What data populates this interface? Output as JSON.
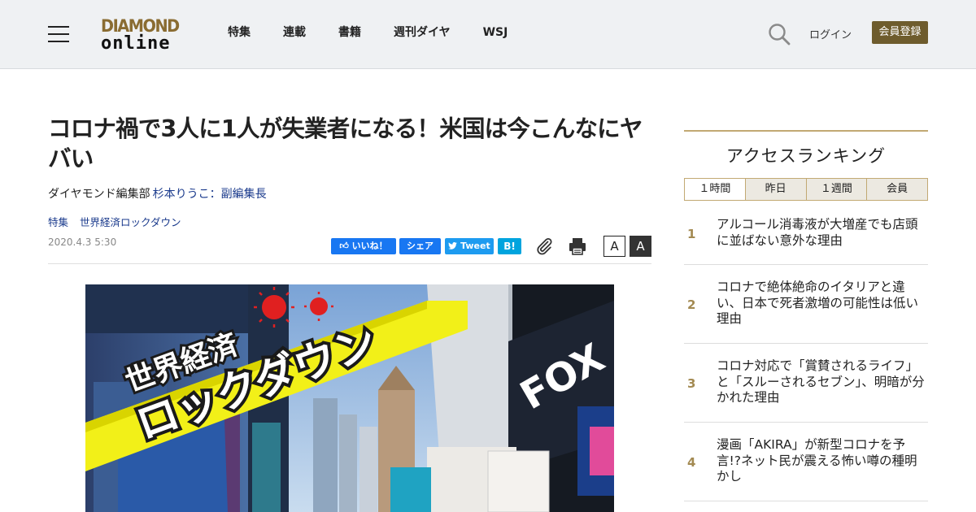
{
  "header": {
    "logo_top": "DIAMOND",
    "logo_bottom": "online",
    "nav": [
      "特集",
      "連載",
      "書籍",
      "週刊ダイヤ",
      "WSJ"
    ],
    "login_label": "ログイン",
    "register_label": "会員登録"
  },
  "article": {
    "title": "コロナ禍で3人に1人が失業者になる！米国は今こんなにヤバい",
    "byline_prefix": "ダイヤモンド編集部",
    "author": "杉本りうこ：副編集長",
    "tags": [
      "特集",
      "世界経済ロックダウン"
    ],
    "date": "2020.4.3 5:30",
    "share": {
      "like": "いいね！",
      "share": "シェア",
      "tweet": "Tweet",
      "hatena": "B!"
    },
    "font_small": "A",
    "font_large": "A",
    "hero": {
      "banner_line1": "世界経済",
      "banner_line2": "ロックダウン",
      "billboard_text": "FOX",
      "banner_color": "#f2f018"
    }
  },
  "ranking": {
    "title": "アクセスランキング",
    "tabs": [
      "１時間",
      "昨日",
      "１週間",
      "会員"
    ],
    "active_tab": 0,
    "items": [
      {
        "rank": "1",
        "text": "アルコール消毒液が大増産でも店頭に並ばない意外な理由"
      },
      {
        "rank": "2",
        "text": "コロナで絶体絶命のイタリアと違い、日本で死者激増の可能性は低い理由"
      },
      {
        "rank": "3",
        "text": "コロナ対応で「賞賛されるライフ」と「スルーされるセブン」、明暗が分かれた理由"
      },
      {
        "rank": "4",
        "text": "漫画「AKIRA」が新型コロナを予言!?ネット民が震える怖い噂の種明かし"
      }
    ]
  },
  "colors": {
    "accent_gold": "#c2a973",
    "register_bg": "#6e5c2d",
    "link_blue": "#1a3a8c"
  }
}
